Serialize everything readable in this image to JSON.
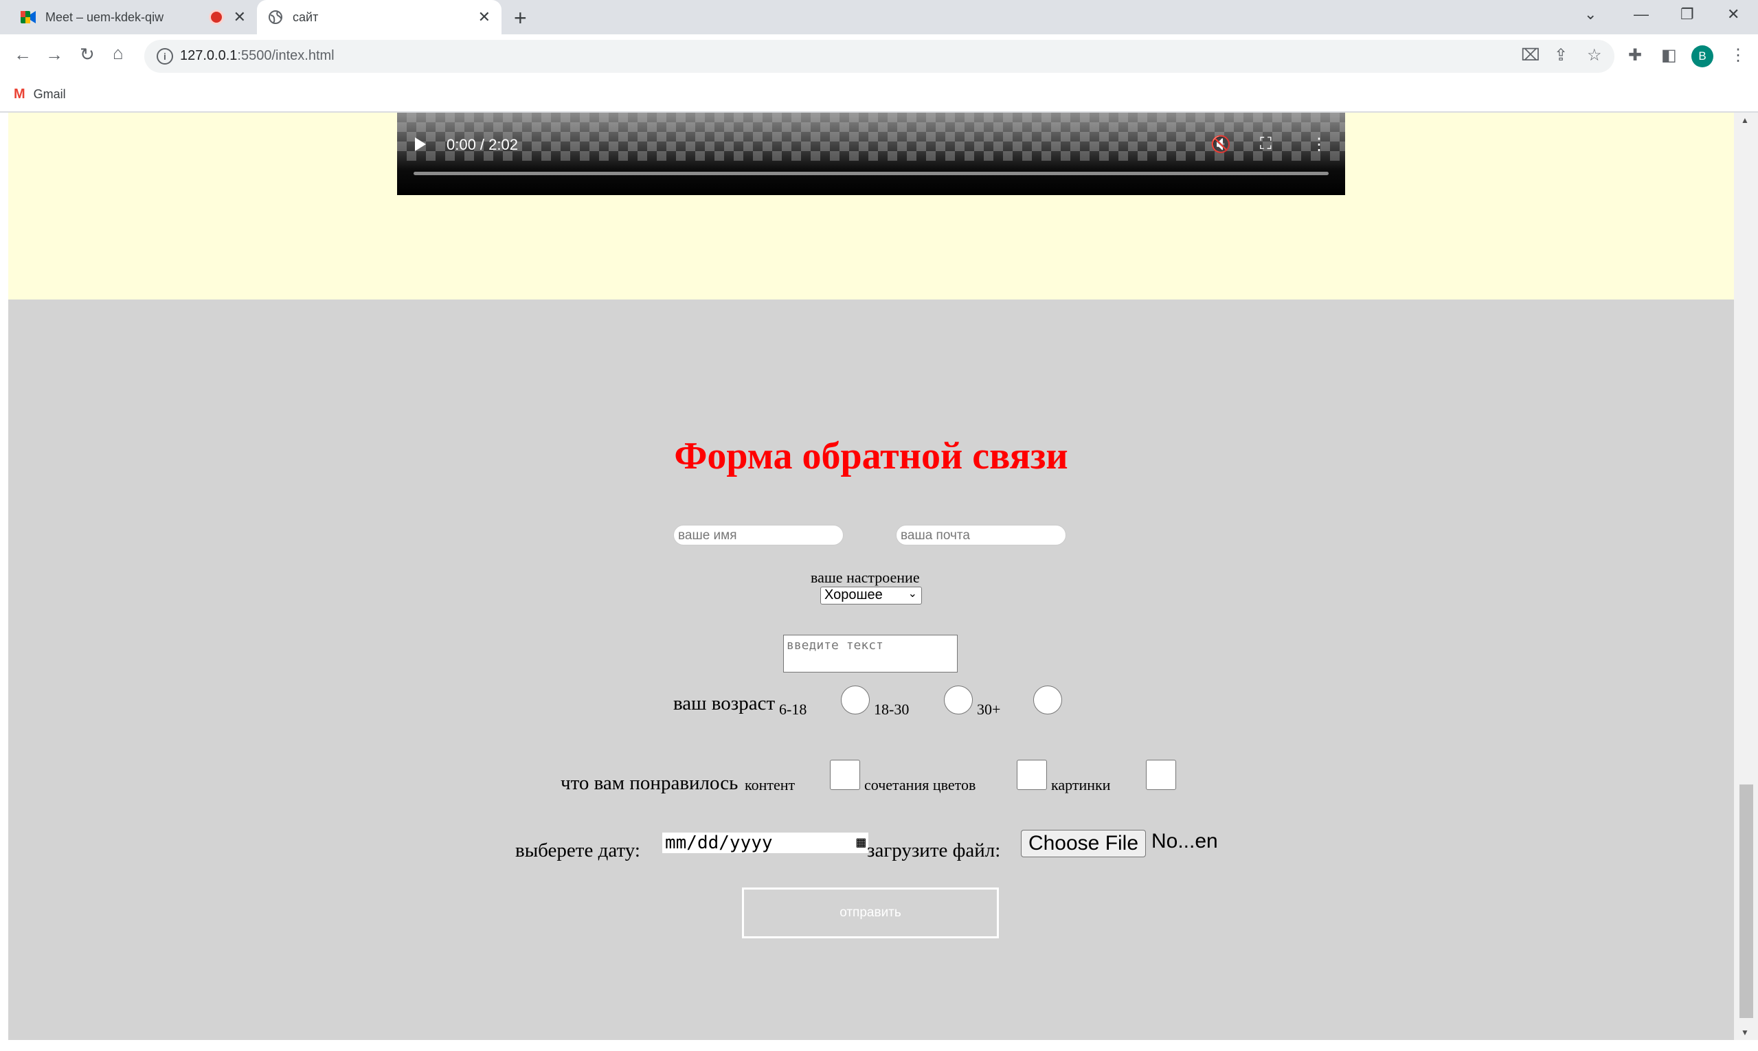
{
  "browser": {
    "tabs": [
      {
        "title": "Meet – uem-kdek-qiw",
        "icon": "google-meet-icon",
        "recording": true
      },
      {
        "title": "сайт",
        "icon": "globe-icon"
      }
    ],
    "new_tab_symbol": "+",
    "address": {
      "host": "127.0.0.1",
      "rest": ":5500/intex.html"
    },
    "profile_initial": "B",
    "bookmarks": [
      {
        "label": "Gmail",
        "icon": "gmail-icon"
      }
    ]
  },
  "video": {
    "time": "0:00 / 2:02"
  },
  "form": {
    "heading": "Форма обратной связи",
    "name_placeholder": "ваше имя",
    "email_placeholder": "ваша почта",
    "mood_label": "ваше настроение",
    "mood_selected": "Хорошее",
    "text_placeholder": "введите текст",
    "age_label": "ваш возраст",
    "age_options": [
      "6-18",
      "18-30",
      "30+"
    ],
    "liked_label": "что вам понравилось",
    "liked_options": [
      "контент",
      "сочетания цветов",
      "картинки"
    ],
    "date_label": "выберете дату:",
    "date_placeholder": "mm/dd/yyyy",
    "file_label": "загрузите файл:",
    "file_button": "Choose File",
    "file_name": "No...en",
    "submit_label": "отправить"
  },
  "colors": {
    "heading": "#ff0000",
    "form_bg": "#d3d3d3",
    "top_section_bg": "#fffedb"
  }
}
